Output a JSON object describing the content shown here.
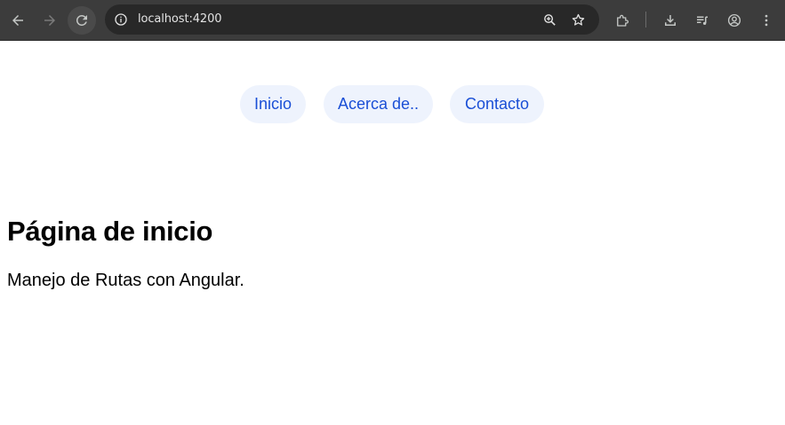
{
  "browser": {
    "url": "localhost:4200",
    "icons": {
      "back": "arrow-left-icon",
      "forward": "arrow-right-icon",
      "reload": "reload-icon",
      "site_info": "info-icon",
      "zoom": "zoom-in-icon",
      "bookmark": "star-icon",
      "extensions": "puzzle-icon",
      "downloads": "download-icon",
      "media": "queue-music-icon",
      "profile": "account-circle-icon",
      "menu": "more-vertical-icon"
    }
  },
  "nav": {
    "items": [
      {
        "label": "Inicio"
      },
      {
        "label": "Acerca de.."
      },
      {
        "label": "Contacto"
      }
    ]
  },
  "main": {
    "title": "Página de inicio",
    "text": "Manejo de Rutas con Angular."
  },
  "colors": {
    "link": "#1a4fd6",
    "pill_bg": "#eef3fd",
    "chrome_bg": "#3c3c3c",
    "omnibox_bg": "#282828"
  }
}
